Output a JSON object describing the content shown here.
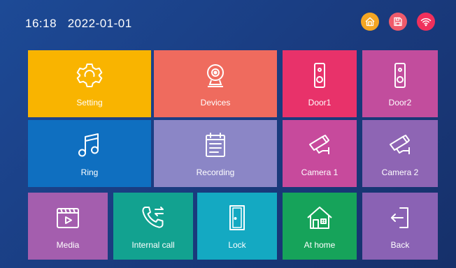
{
  "status_bar": {
    "time": "16:18",
    "date": "2022-01-01",
    "indicators": [
      {
        "icon": "home-mode-icon",
        "color": "#f5a623"
      },
      {
        "icon": "sd-card-icon",
        "color": "#ef5b6b"
      },
      {
        "icon": "wifi-icon",
        "color": "#f0305c"
      }
    ]
  },
  "tiles": [
    {
      "label": "Setting",
      "icon": "gear-icon",
      "color": "#f9b400"
    },
    {
      "label": "Devices",
      "icon": "webcam-icon",
      "color": "#ef6b5e"
    },
    {
      "label": "Door1",
      "icon": "doorbell-icon",
      "color": "#e8326a"
    },
    {
      "label": "Door2",
      "icon": "doorbell-icon",
      "color": "#c24d9d"
    },
    {
      "label": "Ring",
      "icon": "music-note-icon",
      "color": "#0f6fc0"
    },
    {
      "label": "Recording",
      "icon": "calendar-list-icon",
      "color": "#8b86c6"
    },
    {
      "label": "Camera 1",
      "icon": "cctv-camera-icon",
      "color": "#c74a9c"
    },
    {
      "label": "Camera 2",
      "icon": "cctv-camera-icon",
      "color": "#8e65b4"
    },
    {
      "label": "Media",
      "icon": "video-player-icon",
      "color": "#a45eae"
    },
    {
      "label": "Internal call",
      "icon": "phone-transfer-icon",
      "color": "#12a290"
    },
    {
      "label": "Lock",
      "icon": "door-icon",
      "color": "#14a9c2"
    },
    {
      "label": "At home",
      "icon": "house-icon",
      "color": "#16a35a"
    },
    {
      "label": "Back",
      "icon": "exit-icon",
      "color": "#8a62b4"
    }
  ]
}
